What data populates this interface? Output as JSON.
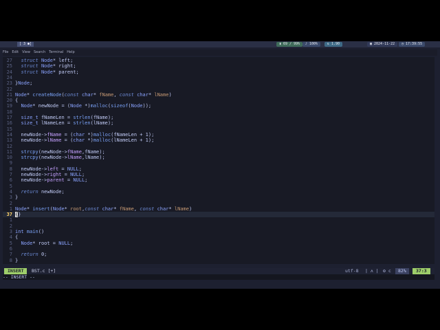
{
  "topbar": {
    "workspace": "[ 3 ●]",
    "modules": [
      {
        "icon": "cpu-icon",
        "text": "69 / 99%"
      },
      {
        "icon": "volume-icon",
        "text": "100%"
      },
      {
        "icon": "network-icon",
        "text": "1.90"
      },
      {
        "icon": "calendar-icon",
        "text": "2024-11-22"
      },
      {
        "icon": "clock-icon",
        "text": "17:39:55"
      }
    ]
  },
  "menubar": {
    "items": [
      "File",
      "Edit",
      "View",
      "Search",
      "Terminal",
      "Help"
    ]
  },
  "editor": {
    "lines": [
      {
        "num": "27",
        "html": "  <span class='it'>struct</span> <span class='k'>Node</span>* left;"
      },
      {
        "num": "25",
        "html": "  <span class='it'>struct</span> <span class='k'>Node</span>* right;"
      },
      {
        "num": "24",
        "html": "  <span class='it'>struct</span> <span class='k'>Node</span>* parent;"
      },
      {
        "num": "24",
        "html": ""
      },
      {
        "num": "23",
        "html": "}<span class='k'>Node</span>;"
      },
      {
        "num": "22",
        "html": ""
      },
      {
        "num": "21",
        "html": "<span class='k'>Node</span>* <span class='fn'>createNode</span>(<span class='it'>const</span> <span class='k'>char</span>* <span class='id'>fName</span>, <span class='it'>const</span> <span class='k'>char</span>* <span class='id'>lName</span>)"
      },
      {
        "num": "20",
        "html": "{"
      },
      {
        "num": "19",
        "html": "  <span class='k'>Node</span>* newNode = (<span class='k'>Node</span> *)<span class='fn'>malloc</span>(<span class='fn'>sizeof</span>(<span class='k'>Node</span>));"
      },
      {
        "num": "18",
        "html": ""
      },
      {
        "num": "17",
        "html": "  <span class='k'>size_t</span> fNameLen = <span class='fn'>strlen</span>(fName);"
      },
      {
        "num": "16",
        "html": "  <span class='k'>size_t</span> lNameLen = <span class='fn'>strlen</span>(lName);"
      },
      {
        "num": "15",
        "html": ""
      },
      {
        "num": "14",
        "html": "  newNode-><span class='op'>fName</span> = (<span class='k'>char</span> *)<span class='fn'>malloc</span>(fNameLen + 1);"
      },
      {
        "num": "13",
        "html": "  newNode-><span class='op'>lName</span> = (<span class='k'>char</span> *)<span class='fn'>malloc</span>(lNameLen + 1);"
      },
      {
        "num": "12",
        "html": ""
      },
      {
        "num": "11",
        "html": "  <span class='fn'>strcpy</span>(newNode-><span class='op'>fName</span>,fName);"
      },
      {
        "num": "10",
        "html": "  <span class='fn'>strcpy</span>(newNode-><span class='op'>lName</span>,lName);"
      },
      {
        "num": "9",
        "html": ""
      },
      {
        "num": "8",
        "html": "  newNode-><span class='op'>left</span> = <span class='k'>NULL</span>;"
      },
      {
        "num": "7",
        "html": "  newNode-><span class='op'>right</span> = <span class='k'>NULL</span>;"
      },
      {
        "num": "6",
        "html": "  newNode-><span class='op'>parent</span> = <span class='k'>NULL</span>;"
      },
      {
        "num": "5",
        "html": ""
      },
      {
        "num": "4",
        "html": "  <span class='it'>return</span> newNode;"
      },
      {
        "num": "3",
        "html": "}"
      },
      {
        "num": "2",
        "html": ""
      },
      {
        "num": "1",
        "html": "<span class='k'>Node</span>* <span class='fn'>insert</span>(<span class='k'>Node</span>* <span class='id'>root</span>,<span class='it'>const</span> <span class='k'>char</span>* <span class='id'>fName</span>, <span class='it'>const</span> <span class='k'>char</span>* <span class='id'>lName</span>)"
      },
      {
        "num": "37",
        "html": "<span class='cursor'>{</span>}",
        "current": true
      },
      {
        "num": "1",
        "html": ""
      },
      {
        "num": "2",
        "html": ""
      },
      {
        "num": "3",
        "html": "<span class='k'>int</span> <span class='fn'>main</span>()"
      },
      {
        "num": "4",
        "html": "{"
      },
      {
        "num": "5",
        "html": "  <span class='k'>Node</span>* root = <span class='k'>NULL</span>;"
      },
      {
        "num": "6",
        "html": ""
      },
      {
        "num": "7",
        "html": "  <span class='it'>return</span> 0;"
      },
      {
        "num": "8",
        "html": "}"
      }
    ]
  },
  "statusline": {
    "mode": "INSERT",
    "file": "BST.c [+]",
    "encoding": "utf-8",
    "separator": "| ʌ |",
    "language": "⚙ c",
    "percent": "82%",
    "position": "37:3"
  },
  "cmdline": {
    "text": "-- INSERT --"
  }
}
